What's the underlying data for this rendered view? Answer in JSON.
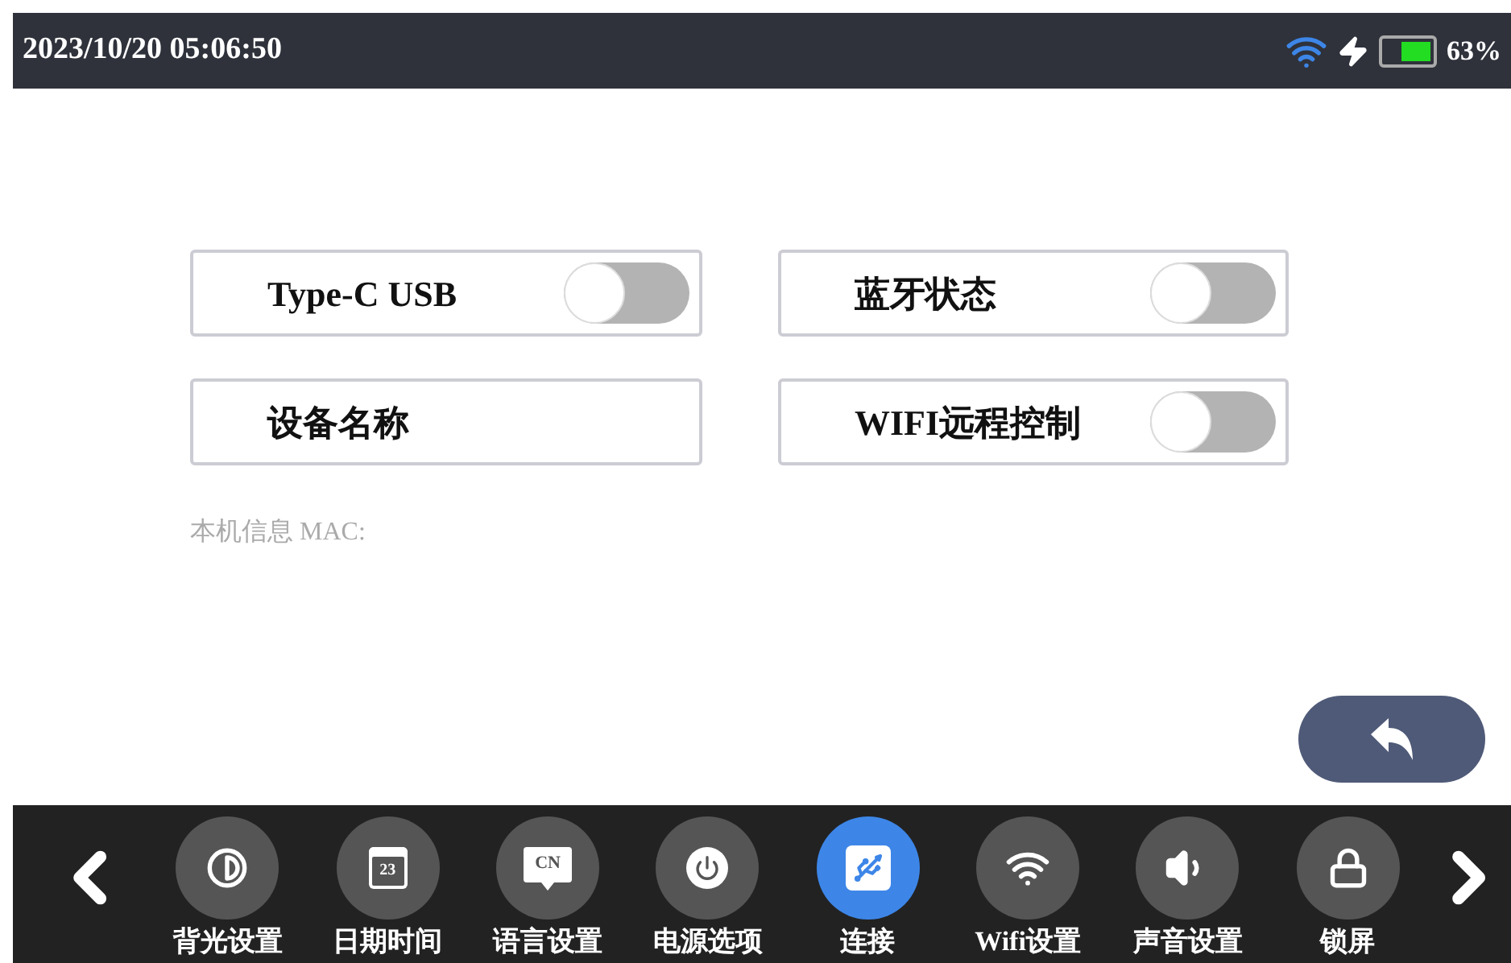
{
  "status_bar": {
    "datetime": "2023/10/20 05:06:50",
    "battery_text": "63%",
    "charging": true
  },
  "settings": [
    {
      "kind": "toggle",
      "label": "Type-C USB",
      "on": false
    },
    {
      "kind": "toggle",
      "label": "蓝牙状态",
      "on": false
    },
    {
      "kind": "text",
      "label": "设备名称"
    },
    {
      "kind": "toggle",
      "label": "WIFI远程控制",
      "on": false
    }
  ],
  "info": "本机信息 MAC:",
  "nav": [
    {
      "kind": "contrast",
      "label": "背光设置",
      "selected": false
    },
    {
      "kind": "calendar",
      "label": "日期时间",
      "icon_text": "23",
      "selected": false
    },
    {
      "kind": "language",
      "label": "语言设置",
      "icon_text": "CN",
      "selected": false
    },
    {
      "kind": "power",
      "label": "电源选项",
      "selected": false
    },
    {
      "kind": "usb",
      "label": "连接",
      "selected": true
    },
    {
      "kind": "wifi",
      "label": "Wifi设置",
      "selected": false
    },
    {
      "kind": "sound",
      "label": "声音设置",
      "selected": false
    },
    {
      "kind": "lock",
      "label": "锁屏",
      "selected": false
    }
  ]
}
